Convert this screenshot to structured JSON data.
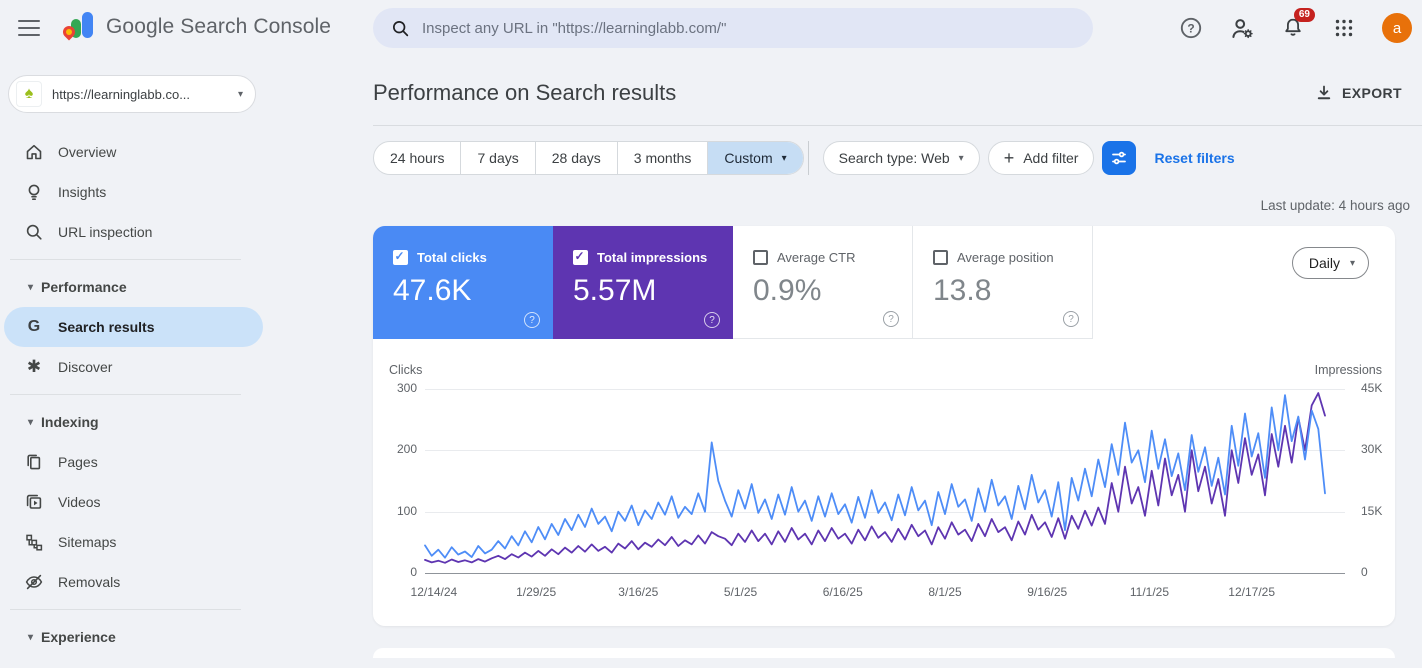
{
  "topbar": {
    "app_title": "Google Search Console",
    "search_placeholder": "Inspect any URL in \"https://learninglabb.com/\"",
    "notification_count": "69",
    "avatar_letter": "a"
  },
  "property": {
    "label": "https://learninglabb.co..."
  },
  "sidebar": {
    "items": [
      {
        "label": "Overview"
      },
      {
        "label": "Insights"
      },
      {
        "label": "URL inspection"
      },
      {
        "label": "Performance"
      },
      {
        "label": "Search results"
      },
      {
        "label": "Discover"
      },
      {
        "label": "Indexing"
      },
      {
        "label": "Pages"
      },
      {
        "label": "Videos"
      },
      {
        "label": "Sitemaps"
      },
      {
        "label": "Removals"
      },
      {
        "label": "Experience"
      }
    ]
  },
  "header": {
    "title": "Performance on Search results",
    "export_label": "EXPORT"
  },
  "filters": {
    "date_ranges": [
      "24 hours",
      "7 days",
      "28 days",
      "3 months"
    ],
    "custom_label": "Custom",
    "search_type_label": "Search type: Web",
    "add_filter_label": "Add filter",
    "reset_label": "Reset filters",
    "last_update": "Last update: 4 hours ago"
  },
  "metrics": {
    "granularity": "Daily",
    "cards": [
      {
        "label": "Total clicks",
        "value": "47.6K",
        "checked": true,
        "bg": "#4a8af4"
      },
      {
        "label": "Total impressions",
        "value": "5.57M",
        "checked": true,
        "bg": "#5e35b1"
      },
      {
        "label": "Average CTR",
        "value": "0.9%",
        "checked": false
      },
      {
        "label": "Average position",
        "value": "13.8",
        "checked": false
      }
    ]
  },
  "icons": {
    "question": "?",
    "caret": "▾",
    "plus": "+",
    "spade": "♠",
    "asterisk": "✱",
    "g": "G"
  },
  "colors": {
    "accent": "#1a73e8",
    "clicks": "#4e8df7",
    "impressions": "#5e35b1",
    "link": "#1a73e8",
    "badge": "#c5221f",
    "avatar": "#e8710a"
  },
  "chart_data": {
    "type": "line",
    "title": "Clicks and impressions over time (daily)",
    "left_axis": {
      "title": "Clicks",
      "ticks": [
        0,
        100,
        200,
        300
      ],
      "max": 300
    },
    "right_axis": {
      "title": "Impressions",
      "ticks": [
        "0",
        "15K",
        "30K",
        "45K"
      ],
      "max": 45000
    },
    "x_ticks": [
      "12/14/24",
      "1/29/25",
      "3/16/25",
      "5/1/25",
      "6/16/25",
      "8/1/25",
      "9/16/25",
      "11/1/25",
      "12/17/25"
    ],
    "x_tick_interval_days": 46,
    "span_days": 414,
    "sample_interval_days": 3,
    "grid": true,
    "series": [
      {
        "name": "Clicks",
        "axis": "left",
        "color": "#4e8df7",
        "values": [
          45,
          28,
          38,
          25,
          42,
          30,
          35,
          26,
          44,
          32,
          38,
          52,
          40,
          60,
          45,
          68,
          50,
          75,
          55,
          80,
          62,
          88,
          70,
          95,
          75,
          105,
          80,
          92,
          68,
          100,
          85,
          110,
          78,
          102,
          88,
          115,
          95,
          125,
          90,
          108,
          96,
          130,
          100,
          213,
          150,
          118,
          92,
          135,
          105,
          145,
          98,
          120,
          88,
          128,
          95,
          140,
          100,
          118,
          85,
          125,
          92,
          130,
          96,
          112,
          82,
          124,
          90,
          135,
          98,
          115,
          86,
          128,
          94,
          140,
          102,
          118,
          78,
          132,
          96,
          145,
          108,
          120,
          85,
          138,
          100,
          152,
          110,
          125,
          88,
          142,
          104,
          160,
          115,
          135,
          92,
          148,
          70,
          155,
          118,
          170,
          125,
          185,
          140,
          210,
          160,
          245,
          180,
          200,
          148,
          232,
          170,
          218,
          158,
          195,
          135,
          225,
          165,
          205,
          142,
          188,
          128,
          240,
          175,
          260,
          190,
          228,
          155,
          270,
          200,
          290,
          215,
          255,
          185,
          265,
          235,
          130
        ]
      },
      {
        "name": "Impressions",
        "axis": "right",
        "color": "#5e35b1",
        "values": [
          3200,
          2600,
          3000,
          2500,
          3300,
          2700,
          3100,
          2600,
          3400,
          2800,
          3600,
          4200,
          3400,
          4600,
          3800,
          5000,
          4000,
          5400,
          4200,
          5800,
          4600,
          6200,
          5000,
          6600,
          5200,
          7000,
          5400,
          6400,
          5000,
          7200,
          6000,
          7800,
          5800,
          7400,
          6400,
          8200,
          6800,
          8800,
          6600,
          8000,
          7000,
          9200,
          7200,
          10000,
          9000,
          8400,
          6800,
          9600,
          7600,
          10400,
          7800,
          9600,
          7000,
          10200,
          7600,
          11000,
          8200,
          9600,
          7000,
          10400,
          7800,
          11000,
          8400,
          9600,
          7200,
          10600,
          8000,
          11400,
          8600,
          10000,
          7600,
          10800,
          8200,
          11800,
          9000,
          10400,
          7000,
          11200,
          8400,
          12400,
          9400,
          10600,
          7800,
          12000,
          9000,
          13200,
          10000,
          11200,
          8000,
          12600,
          9400,
          14200,
          10600,
          12400,
          8800,
          13400,
          8400,
          14000,
          10800,
          15200,
          11600,
          16000,
          12000,
          22000,
          15000,
          26000,
          17000,
          21000,
          14000,
          25000,
          16500,
          28000,
          19000,
          24000,
          15000,
          30000,
          20000,
          26000,
          17000,
          23000,
          14000,
          30000,
          22000,
          33000,
          24000,
          29000,
          19000,
          34000,
          26000,
          36000,
          27000,
          38000,
          30000,
          41000,
          44000,
          38500
        ]
      }
    ]
  }
}
